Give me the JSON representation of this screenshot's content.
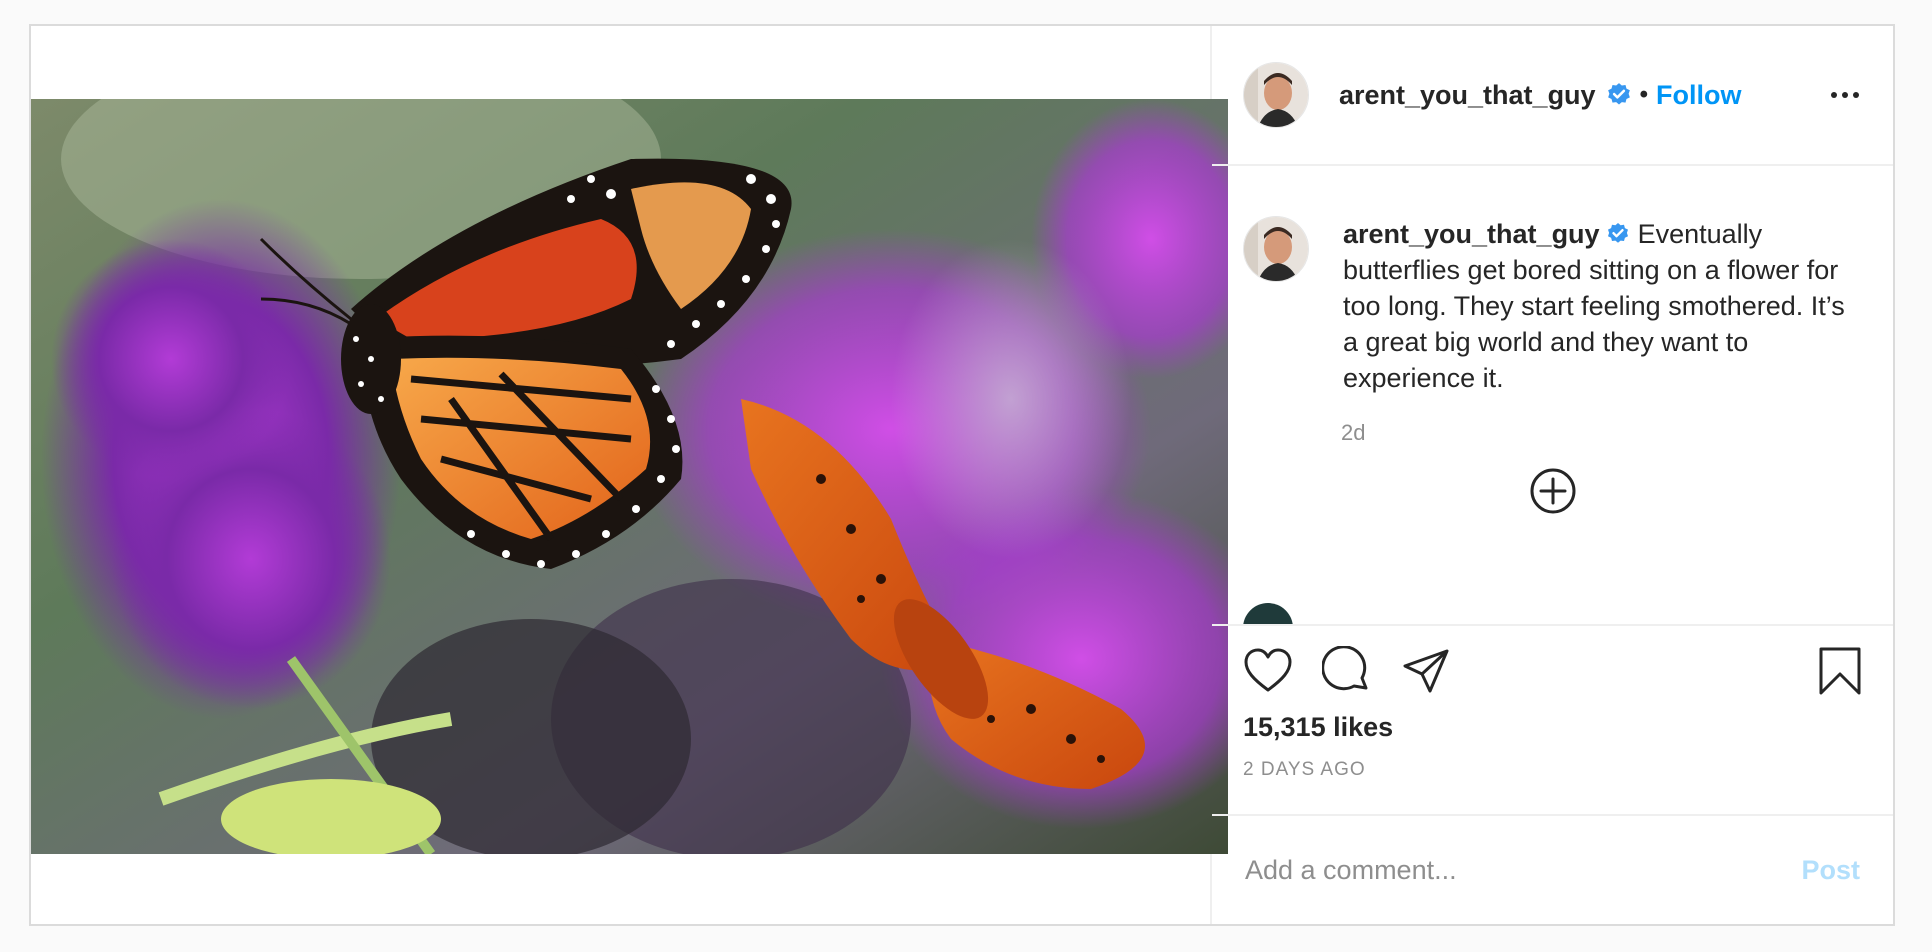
{
  "post": {
    "username": "arent_you_that_guy",
    "follow_label": "Follow",
    "separator": "•",
    "caption_text": "Eventually butterflies get bored sitting on a flower for too long. They start feeling smothered. It’s a great big world and they want to experience it.",
    "time_ago": "2d",
    "likes": "15,315 likes",
    "date": "2 DAYS AGO",
    "comment_placeholder": "Add a comment...",
    "post_label": "Post"
  },
  "icons": {
    "verified": "verified-badge-icon",
    "more": "more-options-icon",
    "load_more": "plus-circle-icon",
    "like": "heart-icon",
    "comment": "comment-bubble-icon",
    "share": "paper-plane-icon",
    "save": "bookmark-icon"
  },
  "colors": {
    "accent": "#0095f6",
    "post_disabled": "#b2dffc",
    "verified": "#3897f0",
    "muted": "#8e8e8e"
  }
}
